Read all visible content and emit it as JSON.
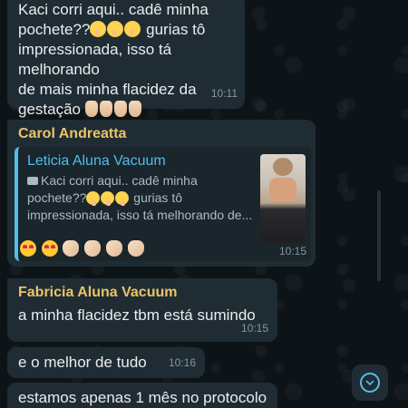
{
  "messages": [
    {
      "id": "msg1",
      "lines": [
        "Kaci corri aqui.. cadê minha",
        "pochete??",
        "gurias tô",
        "impressionada, isso tá melhorando",
        "de mais minha flacidez da",
        "gestação"
      ],
      "time": "10:11"
    },
    {
      "id": "msg2",
      "sender": "Carol Andreatta",
      "sender_color": "#e9c46a",
      "quote": {
        "author": "Leticia Aluna Vacuum",
        "author_color": "#53bdeb",
        "icon": "camera-icon",
        "lines": [
          "Kaci corri aqui.. cadê minha",
          "pochete??",
          "gurias tô",
          "impressionada, isso tá melhorando de..."
        ],
        "thumbnail": "photo-thumbnail"
      },
      "time": "10:15"
    },
    {
      "id": "msg3",
      "sender": "Fabricia Aluna Vacuum",
      "sender_color": "#e9c46a",
      "text": "a minha flacidez tbm está sumindo",
      "time": "10:15"
    },
    {
      "id": "msg4",
      "text": "e o melhor de tudo",
      "time": "10:16"
    },
    {
      "id": "msg5",
      "text": "estamos apenas 1 mês no protocolo"
    }
  ],
  "scroll_button": {
    "icon": "chevron-down-icon"
  },
  "colors": {
    "bubble": "#202c33",
    "background": "#0b141a",
    "accent": "#53bdeb",
    "time": "#8696a0"
  }
}
